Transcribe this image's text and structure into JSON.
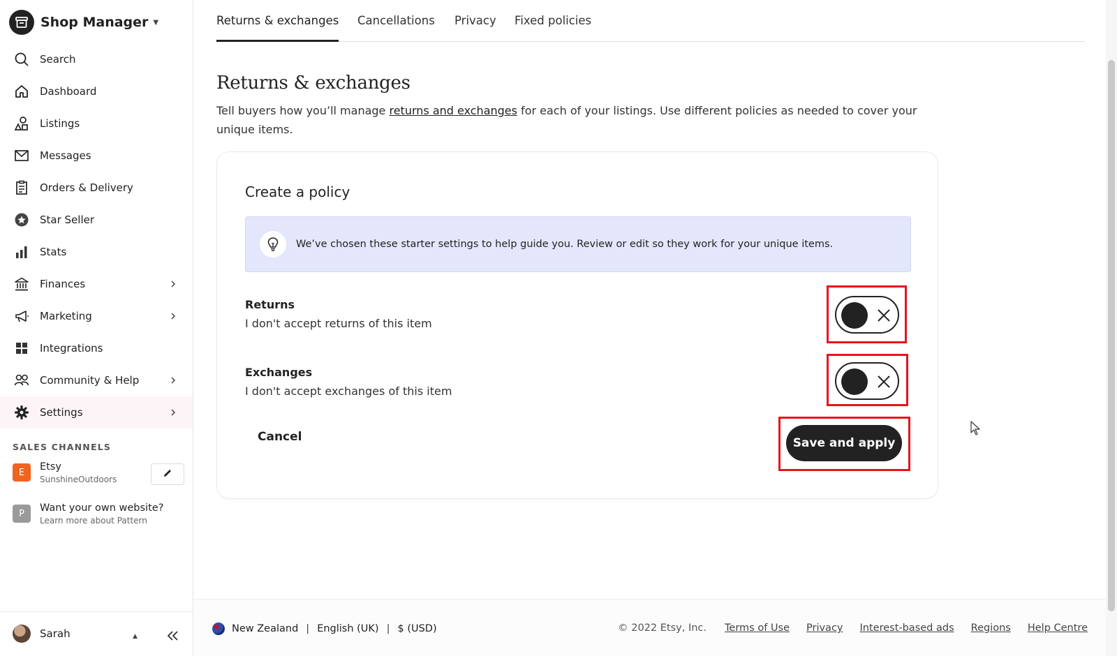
{
  "app": {
    "title": "Shop Manager"
  },
  "sidebar": {
    "items": [
      {
        "label": "Search",
        "icon": "search-icon"
      },
      {
        "label": "Dashboard",
        "icon": "home-icon"
      },
      {
        "label": "Listings",
        "icon": "shapes-icon"
      },
      {
        "label": "Messages",
        "icon": "mail-icon"
      },
      {
        "label": "Orders & Delivery",
        "icon": "clipboard-icon"
      },
      {
        "label": "Star Seller",
        "icon": "star-badge-icon"
      },
      {
        "label": "Stats",
        "icon": "bar-chart-icon"
      },
      {
        "label": "Finances",
        "icon": "bank-icon"
      },
      {
        "label": "Marketing",
        "icon": "megaphone-icon"
      },
      {
        "label": "Integrations",
        "icon": "grid-icon"
      },
      {
        "label": "Community & Help",
        "icon": "people-icon"
      },
      {
        "label": "Settings",
        "icon": "gear-icon"
      }
    ],
    "sales_channels": {
      "title": "SALES CHANNELS",
      "etsy": {
        "badge": "E",
        "name": "Etsy",
        "sub": "SunshineOutdoors",
        "color": "#f1641e"
      },
      "pattern": {
        "badge": "P",
        "name": "Want your own website?",
        "sub": "Learn more about Pattern",
        "color": "#9a9a9a"
      }
    },
    "user": {
      "name": "Sarah"
    }
  },
  "tabs": [
    {
      "label": "Returns & exchanges"
    },
    {
      "label": "Cancellations"
    },
    {
      "label": "Privacy"
    },
    {
      "label": "Fixed policies"
    }
  ],
  "page": {
    "title": "Returns & exchanges",
    "desc_before": "Tell buyers how you’ll manage ",
    "desc_link": "returns and exchanges",
    "desc_after": " for each of your listings. Use different policies as needed to cover your unique items."
  },
  "card": {
    "title": "Create a policy",
    "notice": "We’ve chosen these starter settings to help guide you. Review or edit so they work for your unique items.",
    "returns": {
      "label": "Returns",
      "sub": "I don't accept returns of this item",
      "enabled": false
    },
    "exchanges": {
      "label": "Exchanges",
      "sub": "I don't accept exchanges of this item",
      "enabled": false
    },
    "cancel_label": "Cancel",
    "save_label": "Save and apply"
  },
  "footer": {
    "region": "New Zealand",
    "language": "English (UK)",
    "currency": "$ (USD)",
    "separator": "|",
    "copyright": "© 2022 Etsy, Inc.",
    "links": [
      "Terms of Use",
      "Privacy",
      "Interest-based ads",
      "Regions",
      "Help Centre"
    ]
  },
  "colors": {
    "accent_dark": "#222222",
    "notice_bg": "#e4e7fb",
    "highlight": "#e8141c",
    "active_nav_bg": "#fdf4f8"
  }
}
